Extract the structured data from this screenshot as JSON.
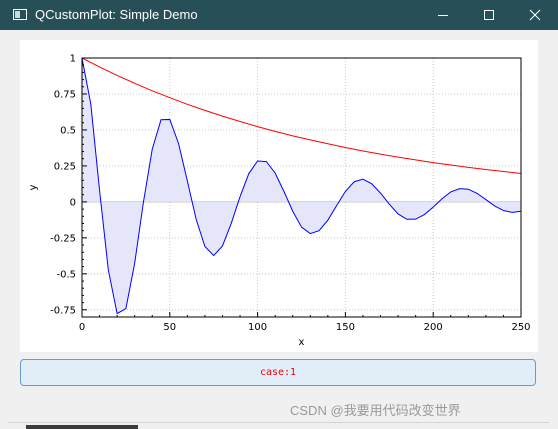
{
  "window": {
    "title": "QCustomPlot: Simple Demo",
    "minimize_glyph": "minimize-icon",
    "maximize_glyph": "maximize-icon",
    "close_glyph": "close-icon"
  },
  "button": {
    "label": "case:1"
  },
  "watermark": "CSDN @我要用代码改变世界",
  "chart_data": {
    "type": "line",
    "xlabel": "x",
    "ylabel": "y",
    "xlim": [
      0,
      250
    ],
    "ylim": [
      -0.8,
      1.0
    ],
    "x_ticks": [
      "0",
      "50",
      "100",
      "150",
      "200",
      "250"
    ],
    "y_ticks": [
      "-0.75",
      "-0.5",
      "-0.25",
      "0",
      "0.25",
      "0.5",
      "0.75",
      "1"
    ],
    "grid": true,
    "series": [
      {
        "color": "#0000ff",
        "fill": "#e6e6fb",
        "x": [
          0,
          5,
          10,
          15,
          20,
          25,
          30,
          35,
          40,
          45,
          50,
          55,
          60,
          65,
          70,
          75,
          80,
          85,
          90,
          95,
          100,
          105,
          110,
          115,
          120,
          125,
          130,
          135,
          140,
          145,
          150,
          155,
          160,
          165,
          170,
          175,
          180,
          185,
          190,
          195,
          200,
          205,
          210,
          215,
          220,
          225,
          230,
          235,
          240,
          245,
          250
        ],
        "y": [
          1.0,
          0.681,
          0.08,
          -0.474,
          -0.776,
          -0.741,
          -0.426,
          0.0,
          0.366,
          0.571,
          0.573,
          0.405,
          0.145,
          -0.121,
          -0.31,
          -0.373,
          -0.306,
          -0.149,
          0.036,
          0.197,
          0.284,
          0.28,
          0.2,
          0.073,
          -0.065,
          -0.175,
          -0.22,
          -0.2,
          -0.127,
          -0.026,
          0.073,
          0.14,
          0.158,
          0.126,
          0.061,
          -0.016,
          -0.084,
          -0.121,
          -0.12,
          -0.088,
          -0.036,
          0.022,
          0.069,
          0.092,
          0.088,
          0.059,
          0.016,
          -0.028,
          -0.06,
          -0.073,
          -0.065
        ]
      },
      {
        "color": "#ff0000",
        "x": [
          0,
          10,
          20,
          30,
          40,
          50,
          60,
          70,
          80,
          90,
          100,
          110,
          120,
          130,
          140,
          150,
          160,
          170,
          180,
          190,
          200,
          210,
          220,
          230,
          240,
          250
        ],
        "y": [
          1.0,
          0.938,
          0.879,
          0.824,
          0.772,
          0.724,
          0.678,
          0.636,
          0.596,
          0.559,
          0.523,
          0.49,
          0.459,
          0.431,
          0.404,
          0.378,
          0.354,
          0.332,
          0.311,
          0.292,
          0.273,
          0.256,
          0.24,
          0.225,
          0.211,
          0.197
        ]
      }
    ]
  }
}
